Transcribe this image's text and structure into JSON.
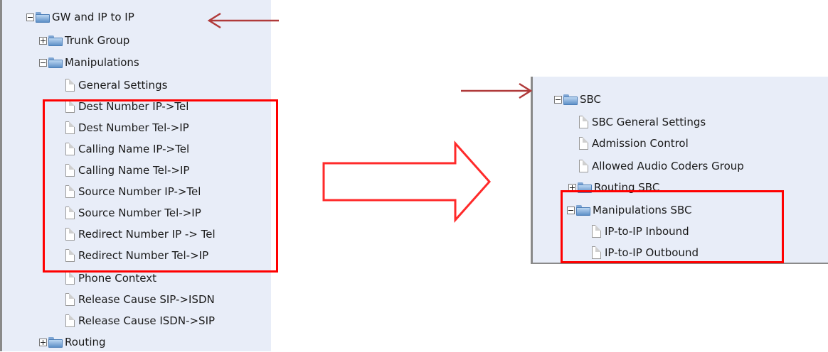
{
  "left_tree": {
    "root": "GW and IP to IP",
    "trunk_group": "Trunk Group",
    "manipulations": "Manipulations",
    "items": [
      "General Settings",
      "Dest Number IP->Tel",
      "Dest Number Tel->IP",
      "Calling Name IP->Tel",
      "Calling Name Tel->IP",
      "Source Number IP->Tel",
      "Source Number Tel->IP",
      "Redirect Number IP -> Tel",
      "Redirect Number Tel->IP",
      "Phone Context",
      "Release Cause SIP->ISDN",
      "Release Cause ISDN->SIP"
    ],
    "routing": "Routing"
  },
  "right_tree": {
    "root": "SBC",
    "items": [
      "SBC General Settings",
      "Admission Control",
      "Allowed Audio Coders Group"
    ],
    "routing_sbc": "Routing SBC",
    "manipulations_sbc": "Manipulations SBC",
    "sub_items": [
      "IP-to-IP Inbound",
      "IP-to-IP Outbound"
    ]
  },
  "colors": {
    "tree_background": "#e8edf8",
    "highlight_box": "#ff0000",
    "pointer_arrow": "#b03a3a"
  }
}
